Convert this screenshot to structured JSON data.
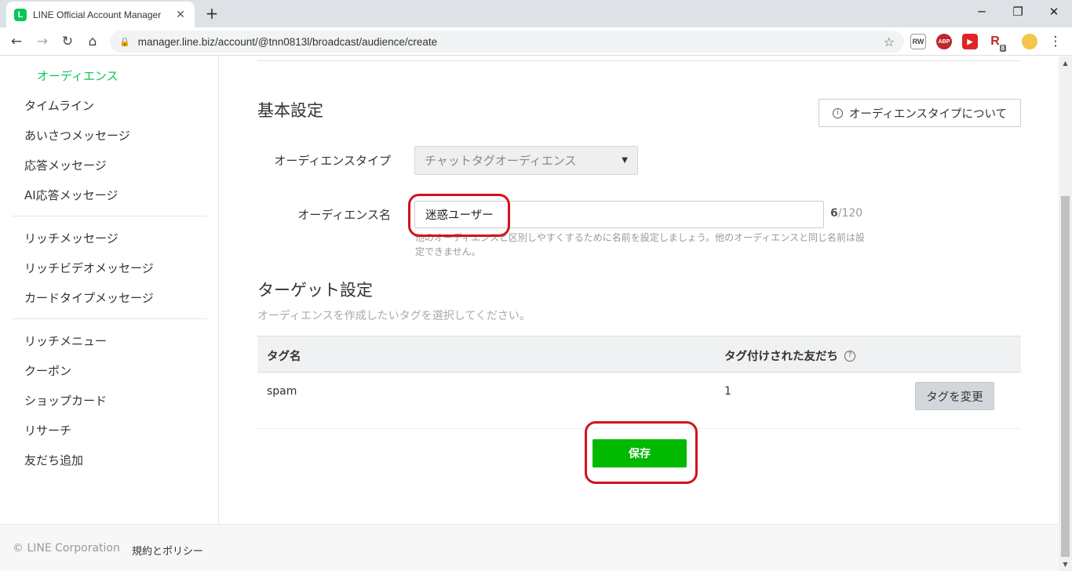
{
  "browser": {
    "tab_title": "LINE Official Account Manager",
    "favicon_letter": "L",
    "url": "manager.line.biz/account/@tnn0813l/broadcast/audience/create",
    "extensions": [
      "RW",
      "ABP",
      "▶",
      "R"
    ],
    "extension_badge": "8"
  },
  "sidebar": {
    "active_item": "オーディエンス",
    "group1": [
      "タイムライン",
      "あいさつメッセージ",
      "応答メッセージ",
      "AI応答メッセージ"
    ],
    "group2": [
      "リッチメッセージ",
      "リッチビデオメッセージ",
      "カードタイプメッセージ"
    ],
    "group3": [
      "リッチメニュー",
      "クーポン",
      "ショップカード",
      "リサーチ",
      "友だち追加"
    ]
  },
  "basic": {
    "heading": "基本設定",
    "about_button": "オーディエンスタイプについて",
    "type_label": "オーディエンスタイプ",
    "type_value": "チャットタグオーディエンス",
    "name_label": "オーディエンス名",
    "name_value": "迷惑ユーザー",
    "name_count": "6",
    "name_max": "/120",
    "help_text": "他のオーディエンスと区別しやすくするために名前を設定しましょう。他のオーディエンスと同じ名前は設定できません。"
  },
  "target": {
    "heading": "ターゲット設定",
    "subtext": "オーディエンスを作成したいタグを選択してください。",
    "col_tag": "タグ名",
    "col_friends": "タグ付けされた友だち",
    "rows": [
      {
        "tag": "spam",
        "count": "1",
        "action": "タグを変更"
      }
    ]
  },
  "save_button": "保存",
  "footer": {
    "copyright": "© LINE Corporation",
    "policy": "規約とポリシー"
  },
  "colors": {
    "brand_green": "#06c755",
    "save_green": "#00b900",
    "annotation_red": "#d4121c"
  }
}
